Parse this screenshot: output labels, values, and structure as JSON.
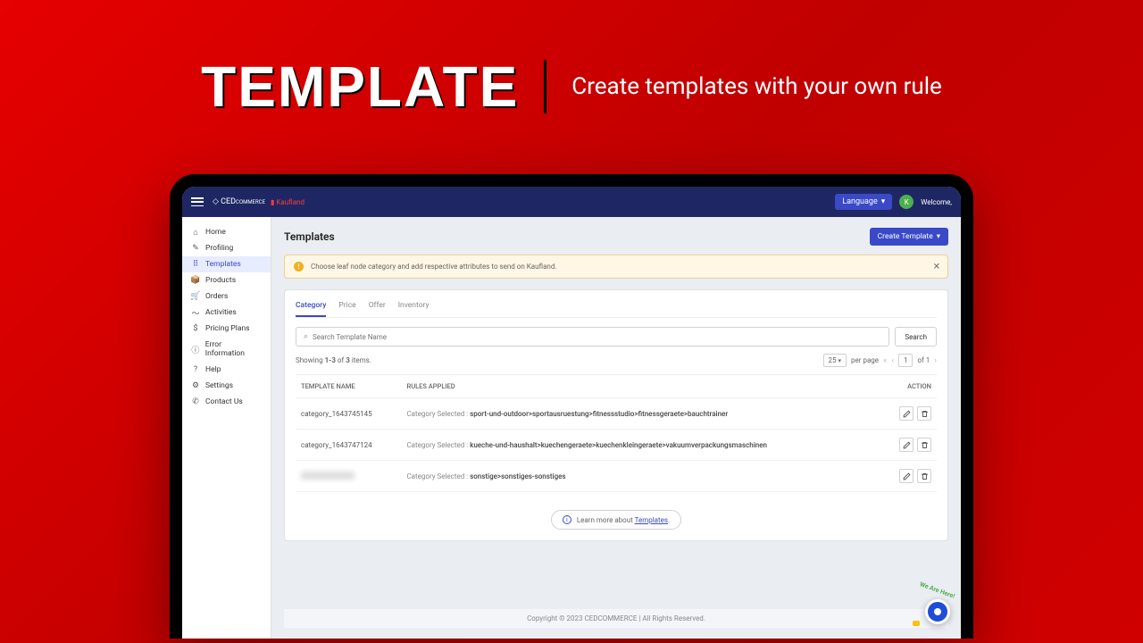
{
  "hero": {
    "title": "TEMPLATE",
    "subtitle": "Create templates with your own rule"
  },
  "topbar": {
    "language_label": "Language",
    "welcome": "Welcome,",
    "avatar_initials": "K"
  },
  "sidebar": {
    "items": [
      {
        "label": "Home",
        "icon": "⌂"
      },
      {
        "label": "Profiling",
        "icon": "✎"
      },
      {
        "label": "Templates",
        "icon": "⠿",
        "active": true
      },
      {
        "label": "Products",
        "icon": "📦"
      },
      {
        "label": "Orders",
        "icon": "🛒"
      },
      {
        "label": "Activities",
        "icon": "〜"
      },
      {
        "label": "Pricing Plans",
        "icon": "$"
      },
      {
        "label": "Error Information",
        "icon": "ⓘ"
      },
      {
        "label": "Help",
        "icon": "?"
      },
      {
        "label": "Settings",
        "icon": "⚙"
      },
      {
        "label": "Contact Us",
        "icon": "✆"
      }
    ]
  },
  "page": {
    "title": "Templates",
    "create_label": "Create Template",
    "alert": "Choose leaf node category and add respective attributes to send on Kaufland.",
    "tabs": [
      "Category",
      "Price",
      "Offer",
      "Inventory"
    ],
    "search_placeholder": "Search Template Name",
    "search_button": "Search",
    "showing_prefix": "Showing ",
    "showing_range": "1-3",
    "showing_mid": " of ",
    "showing_total": "3",
    "showing_suffix": " items.",
    "per_page_value": "25",
    "per_page_label": "per page",
    "page_value": "1",
    "page_of": "of 1",
    "columns": {
      "name": "TEMPLATE NAME",
      "rules": "RULES APPLIED",
      "action": "ACTION"
    },
    "rule_prefix": "Category Selected : ",
    "rows": [
      {
        "name": "category_1643745145",
        "path": "sport-und-outdoor>sportausruestung>fitnessstudio>fitnessgeraete>bauchtrainer"
      },
      {
        "name": "category_1643747124",
        "path": "kueche-und-haushalt>kuechengeraete>kuechenkleingeraete>vakuumverpackungsmaschinen"
      },
      {
        "name": "",
        "path": "sonstige>sonstiges-sonstiges",
        "blurred": true
      }
    ],
    "learn_prefix": "Learn more about ",
    "learn_link": "Templates",
    "footer": "Copyright © 2023 CEDCOMMERCE | All Rights Reserved."
  }
}
